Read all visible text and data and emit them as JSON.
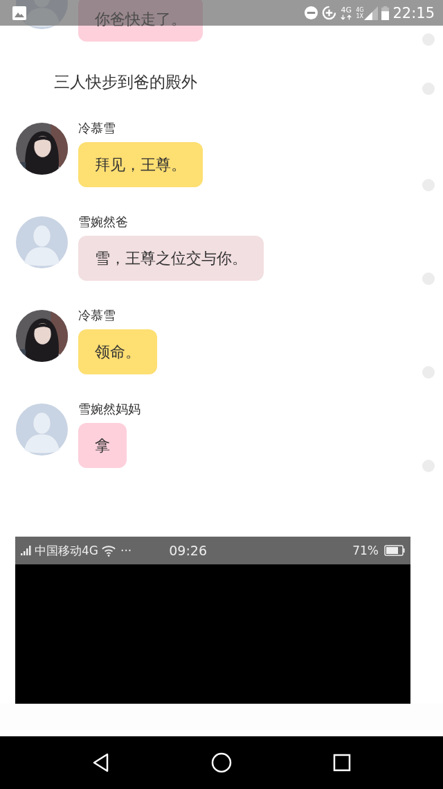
{
  "status_bar": {
    "network_a": "4G",
    "network_b": "4G",
    "network_c": "1X",
    "time": "22:15"
  },
  "messages": [
    {
      "kind": "message",
      "photo_avatar": false,
      "color": "#fdd0dc",
      "text": "你爸快走了。"
    },
    {
      "kind": "narration",
      "text": "三人快步到爸的殿外"
    },
    {
      "kind": "message",
      "photo_avatar": true,
      "name": "冷慕雪",
      "color": "#fddf72",
      "text": "拜见，王尊。"
    },
    {
      "kind": "message",
      "photo_avatar": false,
      "name": "雪婉然爸",
      "color": "#f2dfe1",
      "text": "雪，王尊之位交与你。"
    },
    {
      "kind": "message",
      "photo_avatar": true,
      "name": "冷慕雪",
      "color": "#fddf72",
      "text": "领命。"
    },
    {
      "kind": "message",
      "photo_avatar": false,
      "name": "雪婉然妈妈",
      "color": "#fdd0dc",
      "text": "拿"
    }
  ],
  "embedded_screenshot": {
    "carrier": "中国移动4G",
    "more": "···",
    "time": "09:26",
    "battery": "71%"
  }
}
